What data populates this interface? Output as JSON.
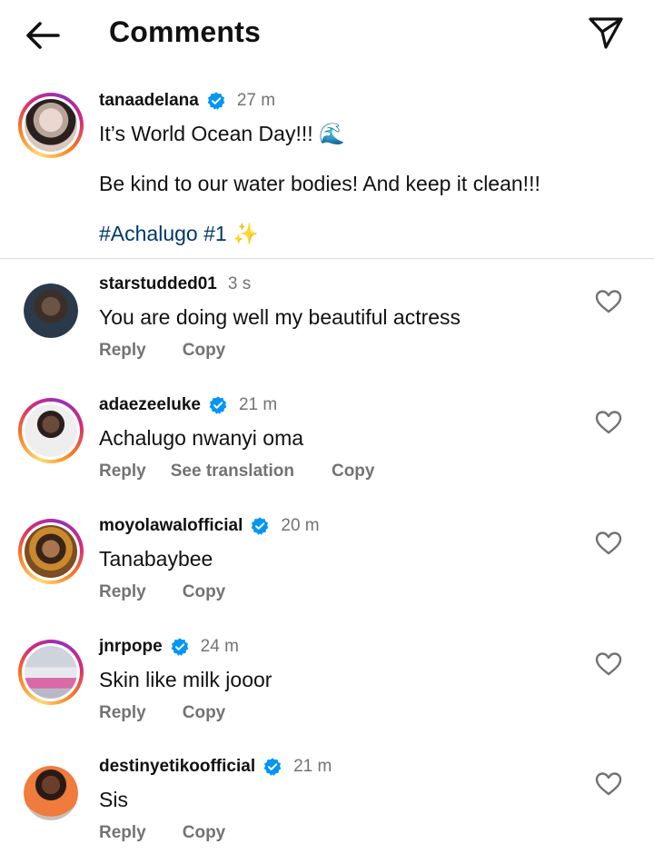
{
  "header": {
    "title": "Comments",
    "back_icon": "arrow-left-icon",
    "share_icon": "paper-plane-icon"
  },
  "caption": {
    "username": "tanaadelana",
    "verified": true,
    "time": "27 m",
    "line1": "It’s World Ocean Day!!! 🌊",
    "line2": "Be kind to our water bodies! And keep it clean!!!",
    "hashtags": "#Achalugo #1",
    "sparkle": "✨"
  },
  "comments": [
    {
      "username": "starstudded01",
      "verified": false,
      "time": "3 s",
      "text": "You are doing well my beautiful actress",
      "reply": "Reply",
      "copy": "Copy"
    },
    {
      "username": "adaezeeluke",
      "verified": true,
      "time": "21 m",
      "text": "Achalugo nwanyi oma",
      "reply": "Reply",
      "translate": "See translation",
      "copy": "Copy"
    },
    {
      "username": "moyolawalofficial",
      "verified": true,
      "time": "20 m",
      "text": "Tanabaybee",
      "reply": "Reply",
      "copy": "Copy"
    },
    {
      "username": "jnrpope",
      "verified": true,
      "time": "24 m",
      "text": "Skin like milk jooor",
      "reply": "Reply",
      "copy": "Copy"
    },
    {
      "username": "destinyetikoofficial",
      "verified": true,
      "time": "21 m",
      "text": "Sis",
      "reply": "Reply",
      "copy": "Copy"
    }
  ],
  "colors": {
    "verified_badge": "#0095f6",
    "secondary_text": "#737373",
    "hashtag": "#00376b"
  }
}
